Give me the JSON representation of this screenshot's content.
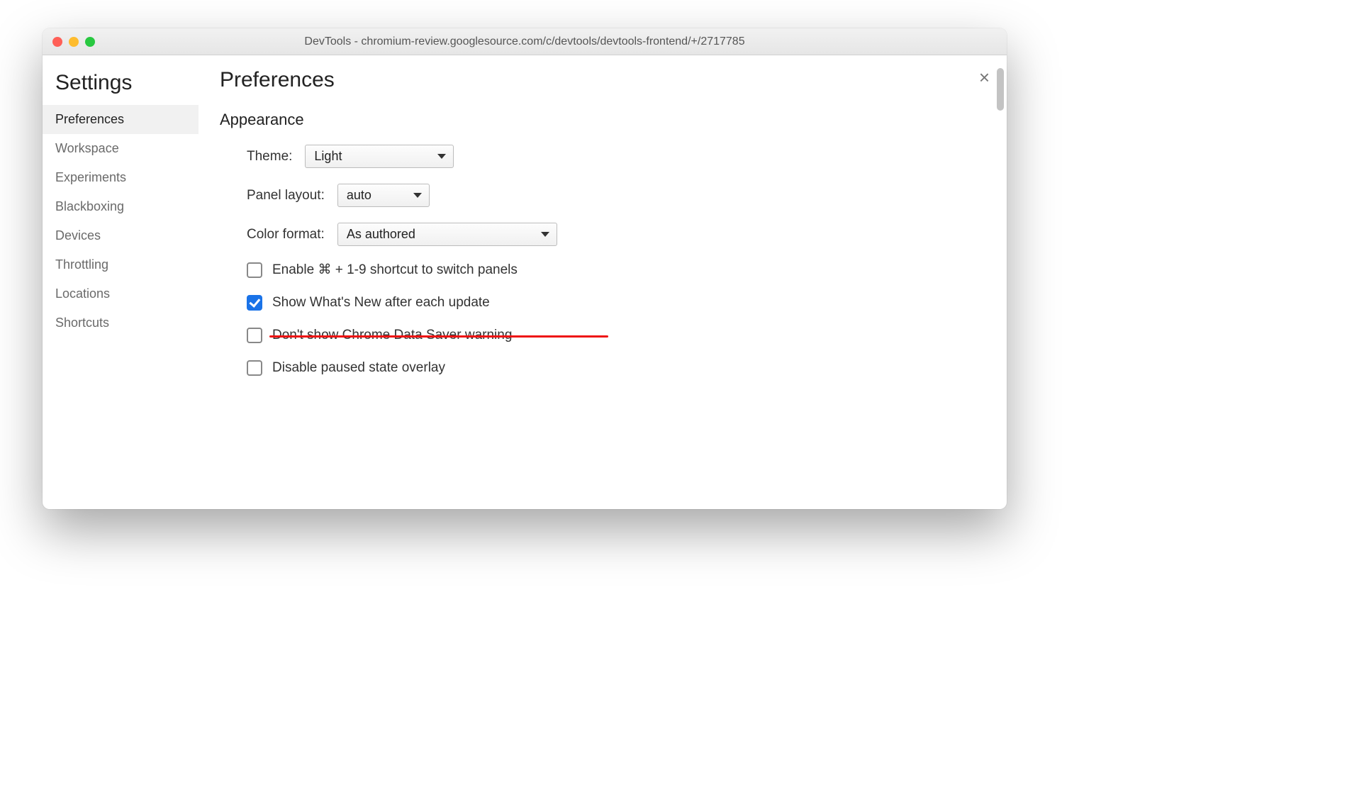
{
  "window": {
    "title": "DevTools - chromium-review.googlesource.com/c/devtools/devtools-frontend/+/2717785"
  },
  "sidebar": {
    "title": "Settings",
    "items": [
      {
        "label": "Preferences",
        "active": true
      },
      {
        "label": "Workspace"
      },
      {
        "label": "Experiments"
      },
      {
        "label": "Blackboxing"
      },
      {
        "label": "Devices"
      },
      {
        "label": "Throttling"
      },
      {
        "label": "Locations"
      },
      {
        "label": "Shortcuts"
      }
    ]
  },
  "page": {
    "title": "Preferences",
    "section": "Appearance",
    "theme": {
      "label": "Theme:",
      "value": "Light"
    },
    "layout": {
      "label": "Panel layout:",
      "value": "auto"
    },
    "colorfmt": {
      "label": "Color format:",
      "value": "As authored"
    },
    "checks": [
      {
        "label": "Enable ⌘ + 1-9 shortcut to switch panels",
        "checked": false,
        "struck": false
      },
      {
        "label": "Show What's New after each update",
        "checked": true,
        "struck": false
      },
      {
        "label": "Don't show Chrome Data Saver warning",
        "checked": false,
        "struck": true
      },
      {
        "label": "Disable paused state overlay",
        "checked": false,
        "struck": false
      }
    ]
  }
}
